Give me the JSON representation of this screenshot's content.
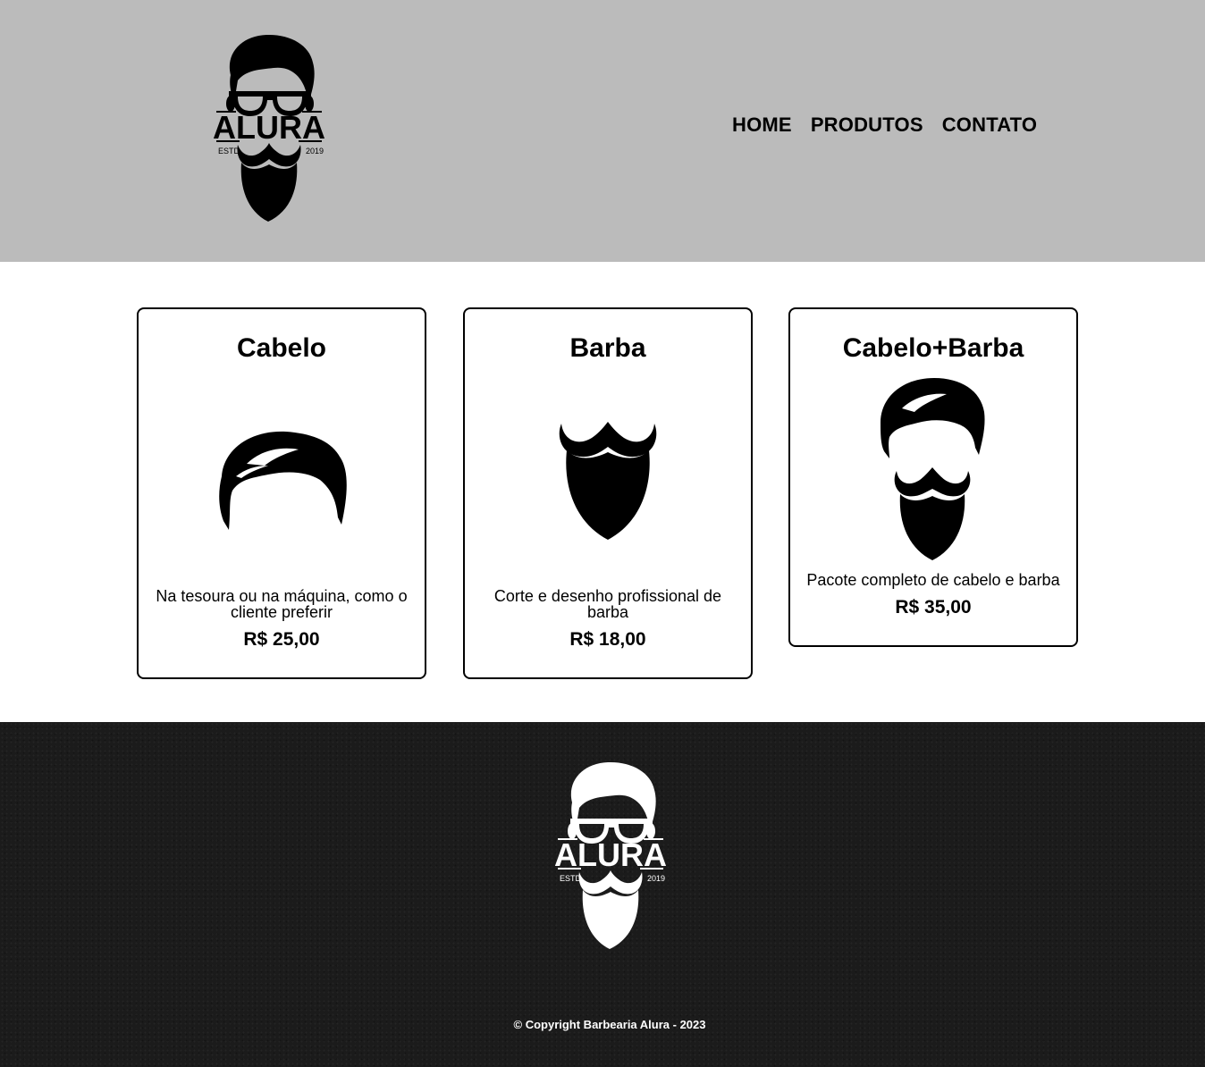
{
  "brand": {
    "name": "ALURA",
    "estd_left": "ESTD",
    "estd_right": "2019"
  },
  "nav": {
    "items": [
      "HOME",
      "PRODUTOS",
      "CONTATO"
    ]
  },
  "cards": [
    {
      "title": "Cabelo",
      "desc": "Na tesoura ou na máquina, como o cliente preferir",
      "price": "R$ 25,00",
      "icon": "hair-icon"
    },
    {
      "title": "Barba",
      "desc": "Corte e desenho profissional de barba",
      "price": "R$ 18,00",
      "icon": "beard-icon"
    },
    {
      "title": "Cabelo+Barba",
      "desc": "Pacote completo de cabelo e barba",
      "price": "R$ 35,00",
      "icon": "hair-beard-icon"
    }
  ],
  "footer": {
    "copyright": "© Copyright Barbearia Alura - 2023"
  },
  "colors": {
    "header_bg": "#bbbbbb",
    "footer_bg": "#1b1b1b",
    "text": "#000000"
  }
}
